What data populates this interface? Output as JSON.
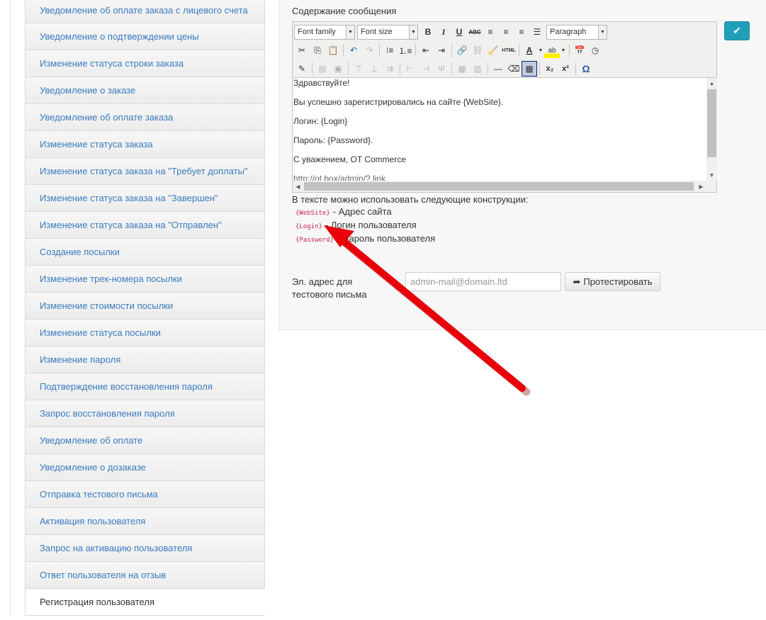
{
  "sidebar": {
    "items": [
      {
        "label": "Уведомление об оплате заказа с лицевого счета"
      },
      {
        "label": "Уведомление о подтверждении цены"
      },
      {
        "label": "Изменение статуса строки заказа"
      },
      {
        "label": "Уведомление о заказе"
      },
      {
        "label": "Уведомление об оплате заказа"
      },
      {
        "label": "Изменение статуса заказа"
      },
      {
        "label": "Изменение статуса заказа на \"Требует доплаты\""
      },
      {
        "label": "Изменение статуса заказа на \"Завершен\""
      },
      {
        "label": "Изменение статуса заказа на \"Отправлен\""
      },
      {
        "label": "Создание посылки"
      },
      {
        "label": "Изменение трек-номера посылки"
      },
      {
        "label": "Изменение стоимости посылки"
      },
      {
        "label": "Изменение статуса посылки"
      },
      {
        "label": "Изменение пароля"
      },
      {
        "label": "Подтверждение восстановления пароля"
      },
      {
        "label": "Запрос восстановления пароля"
      },
      {
        "label": "Уведомление об оплате"
      },
      {
        "label": "Уведомление о дозаказе"
      },
      {
        "label": "Отправка тестового письма"
      },
      {
        "label": "Активация пользователя"
      },
      {
        "label": "Запрос на активацию пользователя"
      },
      {
        "label": "Ответ пользователя на отзыв"
      },
      {
        "label": "Регистрация пользователя",
        "active": true
      }
    ]
  },
  "main": {
    "section_label": "Содержание сообщения",
    "toolbar": {
      "font_family": "Font family",
      "font_size": "Font size",
      "format": "Paragraph",
      "bold": "B",
      "italic": "I",
      "underline": "U",
      "strike": "ABC",
      "html": "HTML",
      "font_color": "A",
      "highlight": "ab",
      "subscript": "x₂",
      "superscript": "x²",
      "omega": "Ω"
    },
    "editor_lines": [
      "Здравствуйте!",
      "Вы успешно зарегистрировались на сайте {WebSite}.",
      "Логин: {Login}",
      "Пароль: {Password}.",
      "С уважением, OT Commerce",
      "http://ot.box/admin/?.link"
    ],
    "hints": {
      "title": "В тексте можно использовать следующие конструкции:",
      "items": [
        {
          "code": "{WebSite}",
          "text": "- Адрес сайта"
        },
        {
          "code": "{Login}",
          "text": "- Логин пользователя"
        },
        {
          "code": "{Password}",
          "text": "- Пароль пользователя"
        }
      ]
    },
    "email_label_line1": "Эл. адрес для",
    "email_label_line2": "тестового письма",
    "email_placeholder": "admin-mail@domain.ltd",
    "test_button": "Протестировать"
  },
  "colors": {
    "accent": "#1fa0b8",
    "link": "#3a7bbf",
    "code": "#c7254e",
    "annotation_arrow": "#e8000b"
  }
}
